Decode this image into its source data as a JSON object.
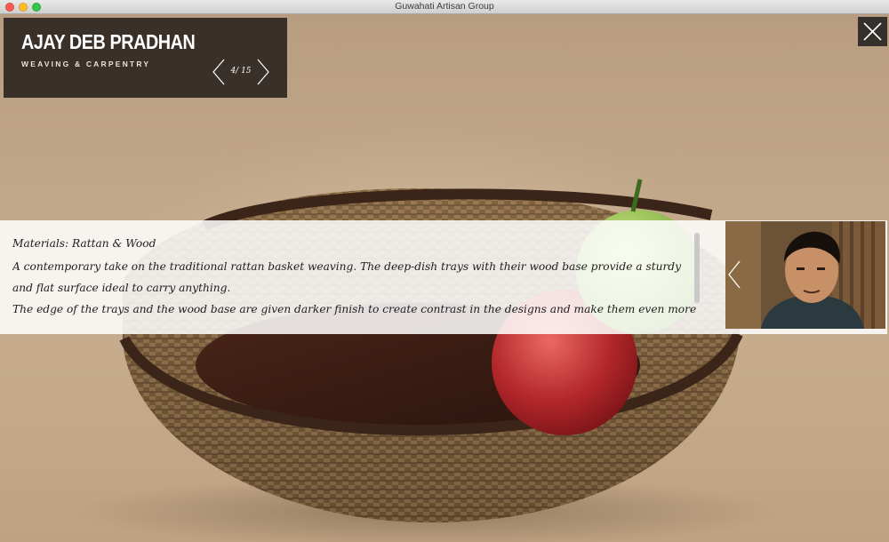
{
  "window": {
    "title": "Guwahati Artisan Group"
  },
  "artisan": {
    "name": "AJAY DEB PRADHAN",
    "craft": "WEAVING & CARPENTRY",
    "pager": {
      "current": 4,
      "total": 15,
      "label": "4/ 15"
    }
  },
  "info": {
    "materials": "Materials: Rattan & Wood",
    "paragraphs": [
      "A contemporary take on the traditional rattan basket weaving. The deep-dish trays with their wood base provide a sturdy and flat surface ideal to carry anything.",
      "The edge of the trays and the wood base are given darker finish to create contrast in the designs and make them even more"
    ]
  },
  "icons": {
    "close": "close-icon",
    "prev": "chevron-left-icon",
    "next": "chevron-right-icon"
  },
  "colors": {
    "label_bg": "#3a302a",
    "background": "#c4aa8b",
    "strip": "#ffffff"
  }
}
